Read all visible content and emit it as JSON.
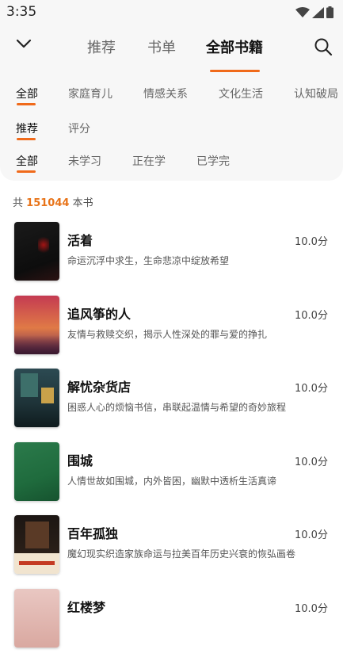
{
  "status": {
    "time": "3:35"
  },
  "header": {
    "tabs": [
      {
        "label": "推荐"
      },
      {
        "label": "书单"
      },
      {
        "label": "全部书籍"
      }
    ]
  },
  "filters": {
    "category": [
      "全部",
      "家庭育儿",
      "情感关系",
      "文化生活",
      "认知破局"
    ],
    "sort": [
      "推荐",
      "评分"
    ],
    "status": [
      "全部",
      "未学习",
      "正在学",
      "已学完"
    ]
  },
  "count": {
    "prefix": "共",
    "value": "151044",
    "suffix": "本书"
  },
  "books": [
    {
      "title": "活着",
      "score": "10.0分",
      "desc": "命运沉浮中求生，生命悲凉中绽放希望"
    },
    {
      "title": "追风筝的人",
      "score": "10.0分",
      "desc": "友情与救赎交织，揭示人性深处的罪与爱的挣扎"
    },
    {
      "title": "解忧杂货店",
      "score": "10.0分",
      "desc": "困惑人心的烦恼书信，串联起温情与希望的奇妙旅程"
    },
    {
      "title": "围城",
      "score": "10.0分",
      "desc": "人情世故如围城，内外皆困，幽默中透析生活真谛"
    },
    {
      "title": "百年孤独",
      "score": "10.0分",
      "desc": "魔幻现实织造家族命运与拉美百年历史兴衰的恢弘画卷"
    },
    {
      "title": "红楼梦",
      "score": "10.0分",
      "desc": ""
    }
  ],
  "colors": {
    "accent": "#f06a1a",
    "count_highlight": "#e8741a",
    "panel_bg": "#f7f7f7"
  },
  "icons": {
    "back": "chevron-down-icon",
    "search": "search-icon"
  }
}
